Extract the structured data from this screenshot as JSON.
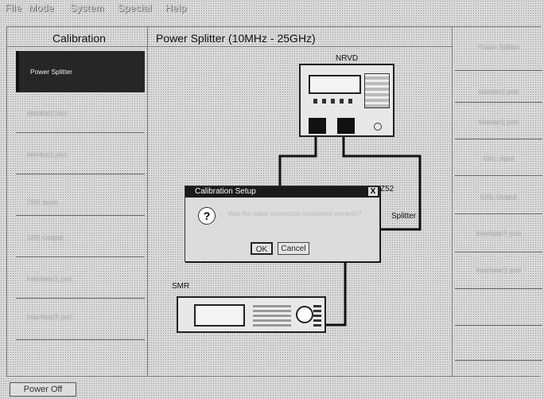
{
  "menu": [
    "File",
    "Mode",
    "System",
    "Special",
    "Help"
  ],
  "left_panel": {
    "header": "Calibration",
    "items": [
      "Power Splitter",
      "Monitor2 port",
      "Monitor1 port",
      "CH1 Input",
      "CH1 Output",
      "Interferer1 port",
      "Interferer2 port"
    ]
  },
  "center": {
    "header": "Power Splitter (10MHz - 25GHz)",
    "nrvd_label": "NRVD",
    "z52_label": "Z52",
    "splitter_label": "Splitter",
    "smr_label": "SMR"
  },
  "right_panel": {
    "items": [
      "Power Splitter",
      "Monitor2 port",
      "Monitor1 port",
      "CH1 Input",
      "CH1 Output",
      "Interferer1 port",
      "Interferer2 port"
    ]
  },
  "dialog": {
    "title": "Calibration Setup",
    "close": "X",
    "message": "Was the cable connection completed correctly?",
    "ok": "OK",
    "cancel": "Cancel"
  },
  "status": {
    "label": "Power Off"
  }
}
